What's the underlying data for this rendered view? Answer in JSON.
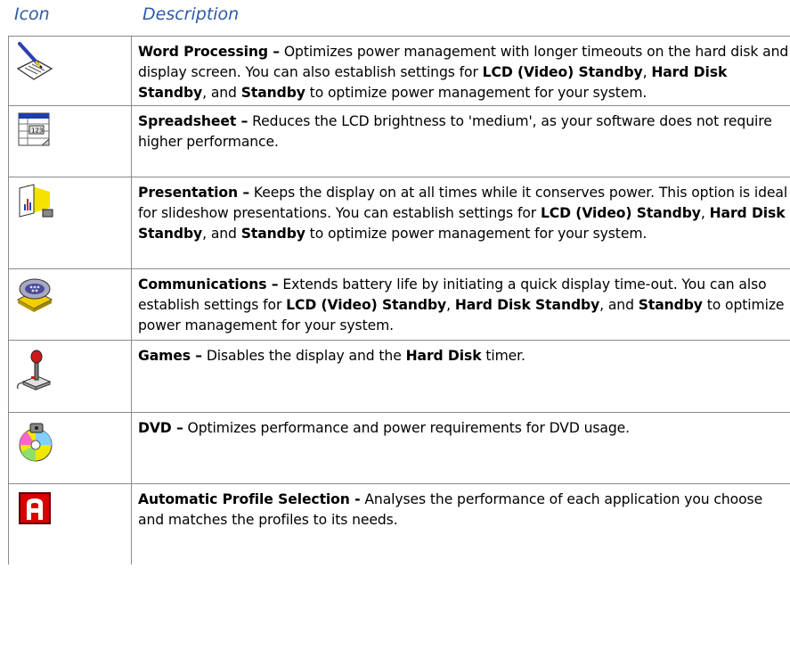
{
  "header": {
    "icon": "Icon",
    "description": "Description"
  },
  "rows": [
    {
      "icon": "word-processing-icon",
      "parts": [
        {
          "t": "Word Processing –",
          "b": true
        },
        {
          "t": " Optimizes power management with longer timeouts on the hard disk and display screen. You can also establish settings for ",
          "b": false
        },
        {
          "t": "LCD (Video) Standby",
          "b": true
        },
        {
          "t": ", ",
          "b": false
        },
        {
          "t": "Hard Disk Standby",
          "b": true
        },
        {
          "t": ", and ",
          "b": false
        },
        {
          "t": "Standby",
          "b": true
        },
        {
          "t": " to optimize power management for your system.",
          "b": false
        }
      ]
    },
    {
      "icon": "spreadsheet-icon",
      "parts": [
        {
          "t": "Spreadsheet –",
          "b": true
        },
        {
          "t": " Reduces the LCD brightness to 'medium', as your software does not require higher performance.",
          "b": false
        }
      ]
    },
    {
      "icon": "presentation-icon",
      "parts": [
        {
          "t": "Presentation –",
          "b": true
        },
        {
          "t": " Keeps the display on at all times while it conserves power. This option is ideal for slideshow presentations. You can establish settings for ",
          "b": false
        },
        {
          "t": "LCD (Video) Standby",
          "b": true
        },
        {
          "t": ", ",
          "b": false
        },
        {
          "t": "Hard Disk Standby",
          "b": true
        },
        {
          "t": ", and ",
          "b": false
        },
        {
          "t": "Standby",
          "b": true
        },
        {
          "t": " to optimize power management for your system.",
          "b": false
        }
      ]
    },
    {
      "icon": "communications-icon",
      "parts": [
        {
          "t": "Communications –",
          "b": true
        },
        {
          "t": " Extends battery life by initiating a quick display time-out. You can also establish settings for ",
          "b": false
        },
        {
          "t": "LCD (Video) Standby",
          "b": true
        },
        {
          "t": ", ",
          "b": false
        },
        {
          "t": "Hard Disk Standby",
          "b": true
        },
        {
          "t": ", and ",
          "b": false
        },
        {
          "t": "Standby",
          "b": true
        },
        {
          "t": " to optimize power management for your system.",
          "b": false
        }
      ]
    },
    {
      "icon": "games-joystick-icon",
      "parts": [
        {
          "t": "Games –",
          "b": true
        },
        {
          "t": " Disables the display and the ",
          "b": false
        },
        {
          "t": "Hard Disk",
          "b": true
        },
        {
          "t": " timer.",
          "b": false
        }
      ]
    },
    {
      "icon": "dvd-icon",
      "parts": [
        {
          "t": "DVD –",
          "b": true
        },
        {
          "t": " Optimizes performance and power requirements for DVD usage.",
          "b": false
        }
      ]
    },
    {
      "icon": "automatic-profile-icon",
      "parts": [
        {
          "t": "Automatic Profile Selection -",
          "b": true
        },
        {
          "t": " Analyses the performance of each application you choose and matches the profiles to its needs.",
          "b": false
        }
      ]
    }
  ]
}
